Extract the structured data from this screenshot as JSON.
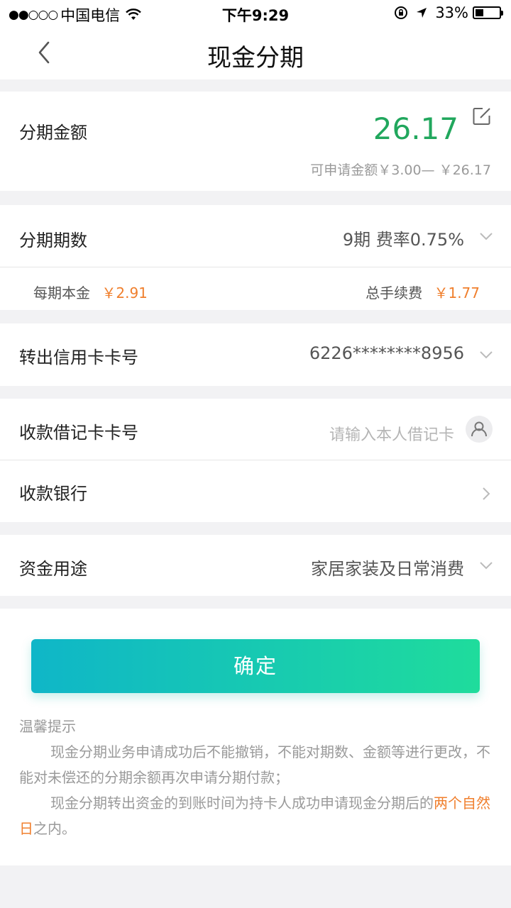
{
  "status_bar": {
    "signal": "●●○○○",
    "carrier": "中国电信",
    "time": "下午9:29",
    "battery": "33%",
    "battery_level": 0.33
  },
  "nav": {
    "title": "现金分期"
  },
  "amount_section": {
    "label": "分期金额",
    "value": "26.17",
    "range": "可申请金额￥3.00— ￥26.17"
  },
  "installments": {
    "label": "分期期数",
    "value": "9期 费率0.75%",
    "principal_label": "每期本金",
    "principal_value": "￥2.91",
    "fee_label": "总手续费",
    "fee_value": "￥1.77"
  },
  "credit_card": {
    "label": "转出信用卡卡号",
    "value": "6226********8956"
  },
  "debit_card": {
    "label": "收款借记卡卡号",
    "placeholder": "请输入本人借记卡"
  },
  "bank": {
    "label": "收款银行"
  },
  "purpose": {
    "label": "资金用途",
    "value": "家居家装及日常消费"
  },
  "confirm_button": "确定",
  "tips": {
    "title": "温馨提示",
    "line1": "现金分期业务申请成功后不能撤销，不能对期数、金额等进行更改，不能对未偿还的分期余额再次申请分期付款；",
    "line2_prefix": "现金分期转出资金的到账时间为持卡人成功申请现金分期后的",
    "line2_highlight": "两个自然日",
    "line2_suffix": "之内。"
  },
  "colors": {
    "accent_green": "#21a75d",
    "accent_orange": "#f07f2d",
    "button_gradient_start": "#0fb6c8",
    "button_gradient_end": "#1fdc9c"
  }
}
